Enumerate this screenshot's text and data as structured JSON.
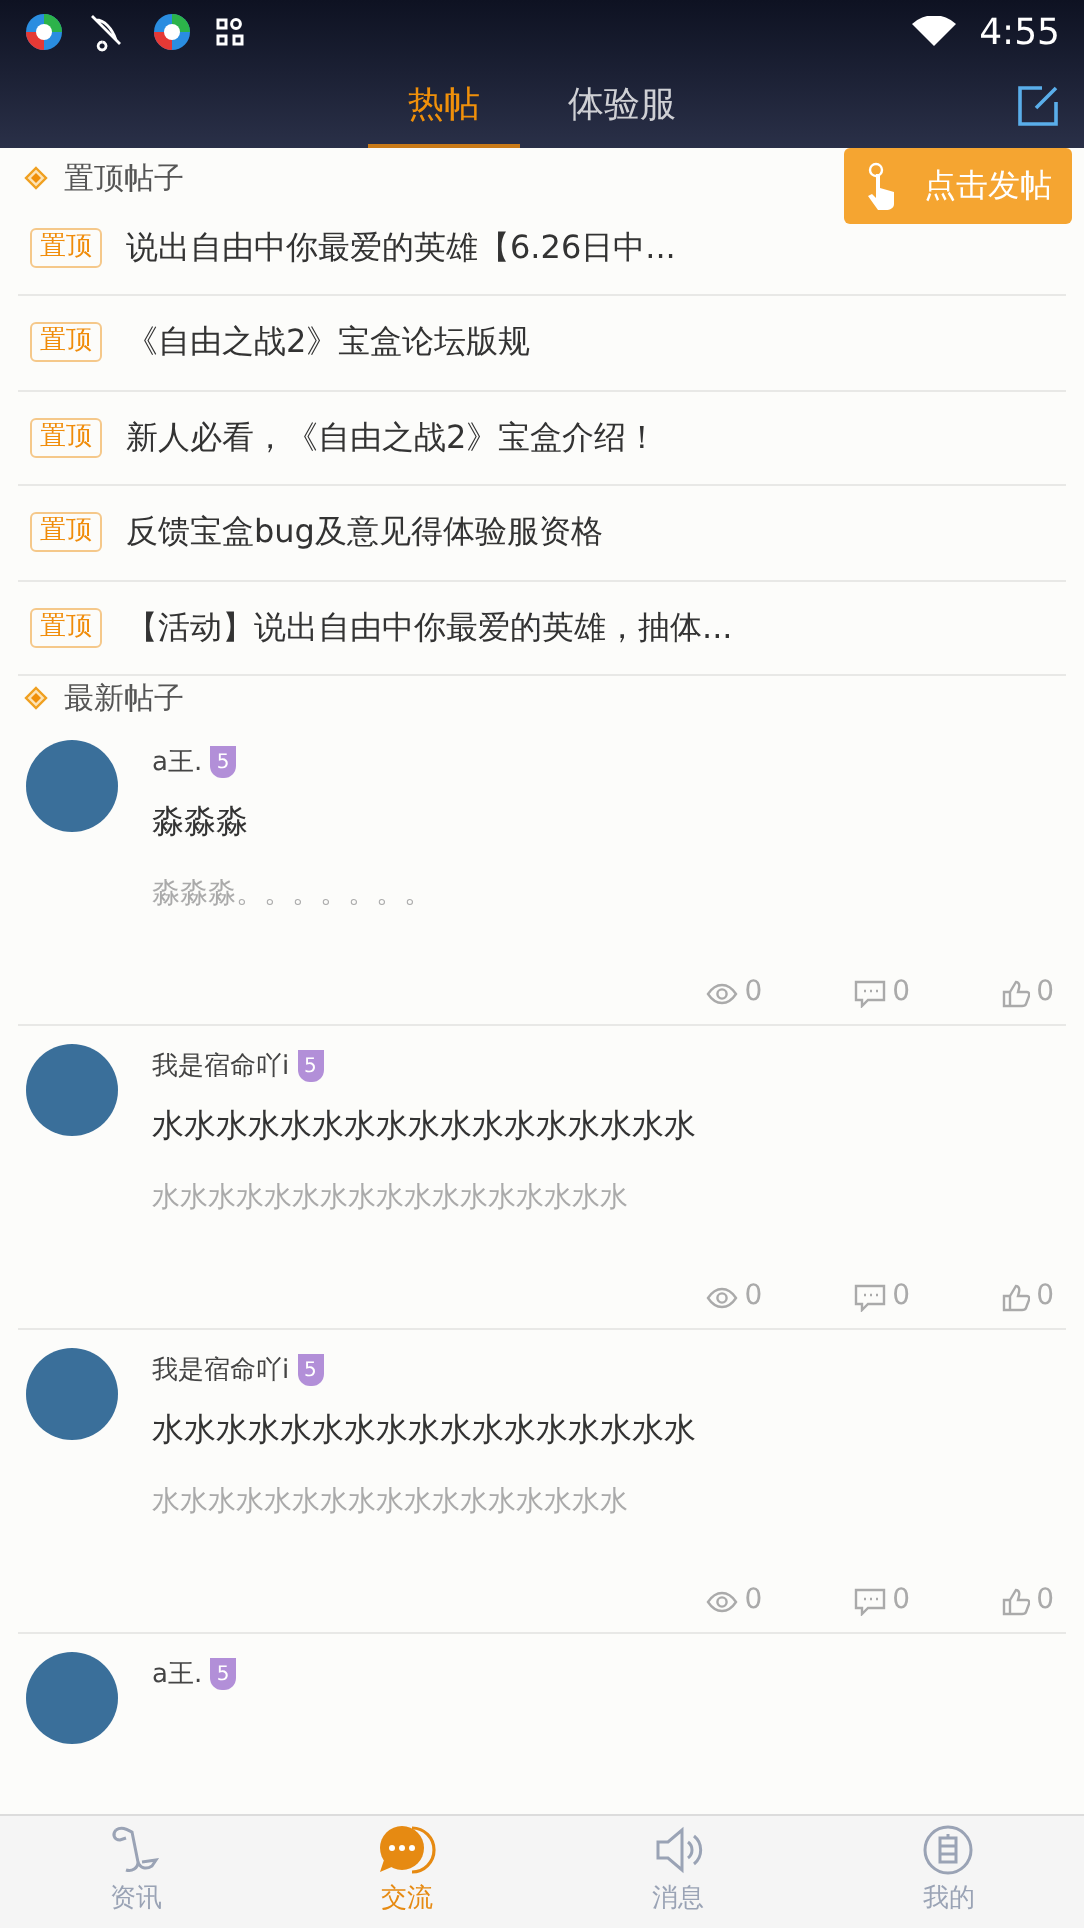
{
  "status_bar": {
    "time": "4:55"
  },
  "header": {
    "tabs": [
      {
        "label": "热帖",
        "selected": true
      },
      {
        "label": "体验服",
        "selected": false
      }
    ],
    "tooltip": "点击发帖"
  },
  "pinned": {
    "title": "置顶帖子",
    "items": [
      {
        "tag": "置顶",
        "title": "说出自由中你最爱的英雄【6.26日中..."
      },
      {
        "tag": "置顶",
        "title": "《自由之战2》宝盒论坛版规"
      },
      {
        "tag": "置顶",
        "title": "新人必看，《自由之战2》宝盒介绍！"
      },
      {
        "tag": "置顶",
        "title": "反馈宝盒bug及意见得体验服资格"
      },
      {
        "tag": "置顶",
        "title": "【活动】说出自由中你最爱的英雄，抽体..."
      }
    ]
  },
  "latest": {
    "title": "最新帖子",
    "posts": [
      {
        "author": "a王.",
        "level": "5",
        "title": "淼淼淼",
        "excerpt": "淼淼淼。。。。。。。",
        "views": "0",
        "comments": "0",
        "likes": "0"
      },
      {
        "author": "我是宿命吖i",
        "level": "5",
        "title": "水水水水水水水水水水水水水水水水水",
        "excerpt": "水水水水水水水水水水水水水水水水水",
        "views": "0",
        "comments": "0",
        "likes": "0"
      },
      {
        "author": "我是宿命吖i",
        "level": "5",
        "title": "水水水水水水水水水水水水水水水水水",
        "excerpt": "水水水水水水水水水水水水水水水水水",
        "views": "0",
        "comments": "0",
        "likes": "0"
      },
      {
        "author": "a王.",
        "level": "5"
      }
    ]
  },
  "nav": [
    {
      "label": "资讯",
      "kind": "news",
      "selected": false
    },
    {
      "label": "交流",
      "kind": "chat",
      "selected": true
    },
    {
      "label": "消息",
      "kind": "sound",
      "selected": false
    },
    {
      "label": "我的",
      "kind": "me",
      "selected": false
    }
  ]
}
